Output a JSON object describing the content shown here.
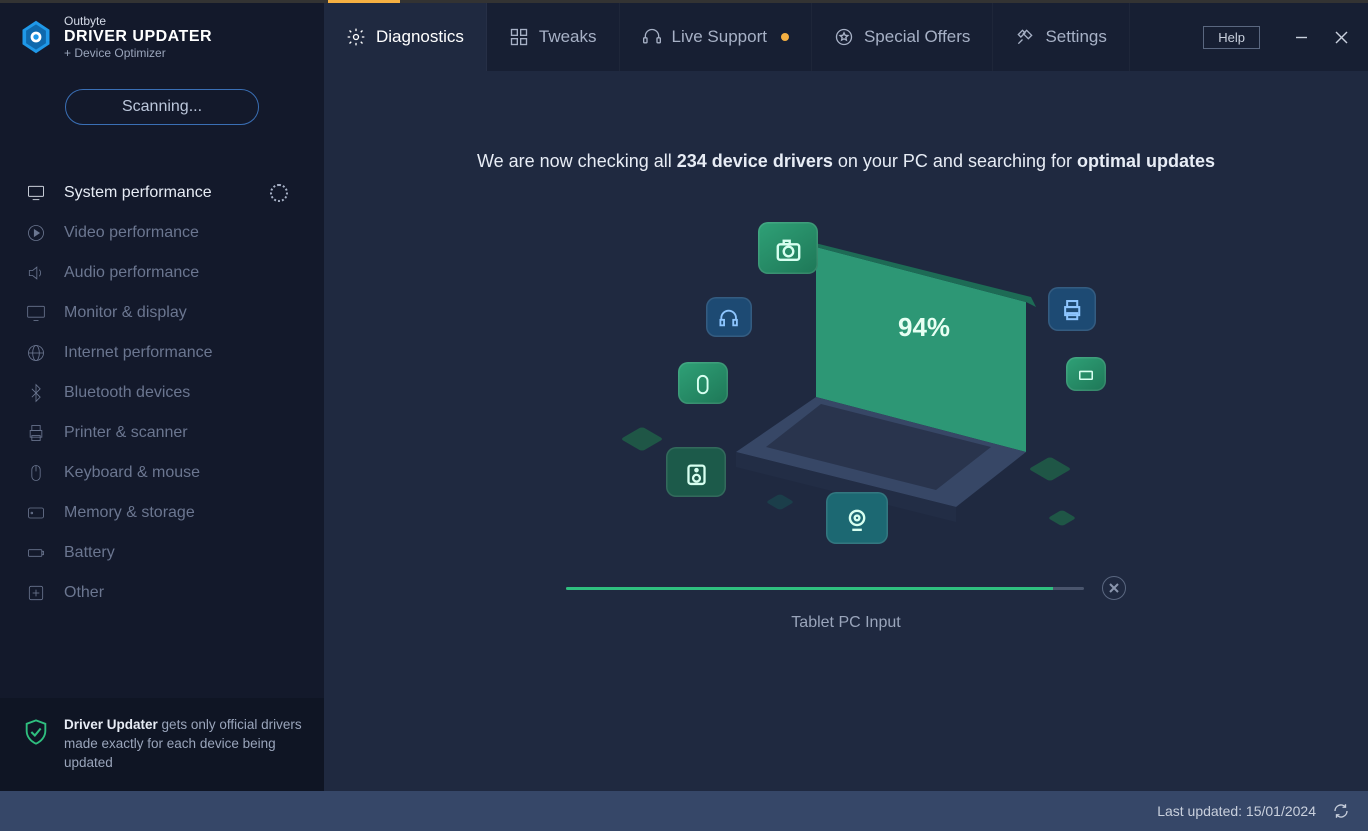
{
  "brand": {
    "line1": "Outbyte",
    "line2": "DRIVER UPDATER",
    "line3": "+ Device Optimizer"
  },
  "tabs": {
    "diagnostics": "Diagnostics",
    "tweaks": "Tweaks",
    "live_support": "Live Support",
    "special_offers": "Special Offers",
    "settings": "Settings"
  },
  "help": "Help",
  "sidebar": {
    "scanning": "Scanning...",
    "items": [
      "System performance",
      "Video performance",
      "Audio performance",
      "Monitor & display",
      "Internet performance",
      "Bluetooth devices",
      "Printer & scanner",
      "Keyboard & mouse",
      "Memory & storage",
      "Battery",
      "Other"
    ],
    "footer_bold": "Driver Updater",
    "footer_rest": " gets only official drivers made exactly for each device being updated"
  },
  "main": {
    "head_pre": "We are now checking all ",
    "head_bold1": "234 device drivers",
    "head_mid": " on your PC and searching for ",
    "head_bold2": "optimal updates",
    "percent": "94%",
    "progress_pct": 94,
    "progress_label": "Tablet PC Input"
  },
  "statusbar": {
    "last_updated": "Last updated: 15/01/2024"
  }
}
